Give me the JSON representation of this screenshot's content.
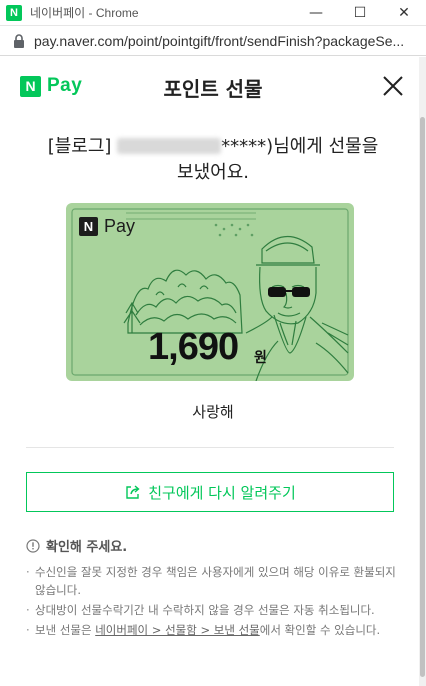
{
  "window": {
    "app_badge": "N",
    "title": "네이버페이 - Chrome",
    "controls": {
      "minimize": "—",
      "maximize": "☐",
      "close": "✕"
    },
    "url": "pay.naver.com/point/pointgift/front/sendFinish?packageSe..."
  },
  "header": {
    "logo_n": "N",
    "logo_pay": "Pay",
    "title": "포인트 선물",
    "close_icon": "close-icon"
  },
  "message": {
    "prefix": "[블로그] ",
    "masked_name": "*****)",
    "suffix_line1": "님에게 선물을",
    "line2": "보냈어요."
  },
  "card": {
    "logo_n": "N",
    "logo_pay": "Pay",
    "amount": "1,690",
    "unit": "원",
    "colors": {
      "background": "#a9d39c",
      "line": "#2f7d3f"
    }
  },
  "gift_message": "사랑해",
  "resend_button": {
    "label": "친구에게 다시 알려주기",
    "icon": "share-icon"
  },
  "notice": {
    "title": "확인해 주세요.",
    "items": [
      {
        "text": "수신인을 잘못 지정한 경우 책임은 사용자에게 있으며 해당 이유로 환불되지 않습니다."
      },
      {
        "text": "상대방이 선물수락기간 내 수락하지 않을 경우 선물은 자동 취소됩니다."
      },
      {
        "before": "보낸 선물은 ",
        "link": "네이버페이 > 선물함 > 보낸 선물",
        "after": "에서 확인할 수 있습니다."
      }
    ]
  },
  "colors": {
    "accent": "#03c75a"
  }
}
